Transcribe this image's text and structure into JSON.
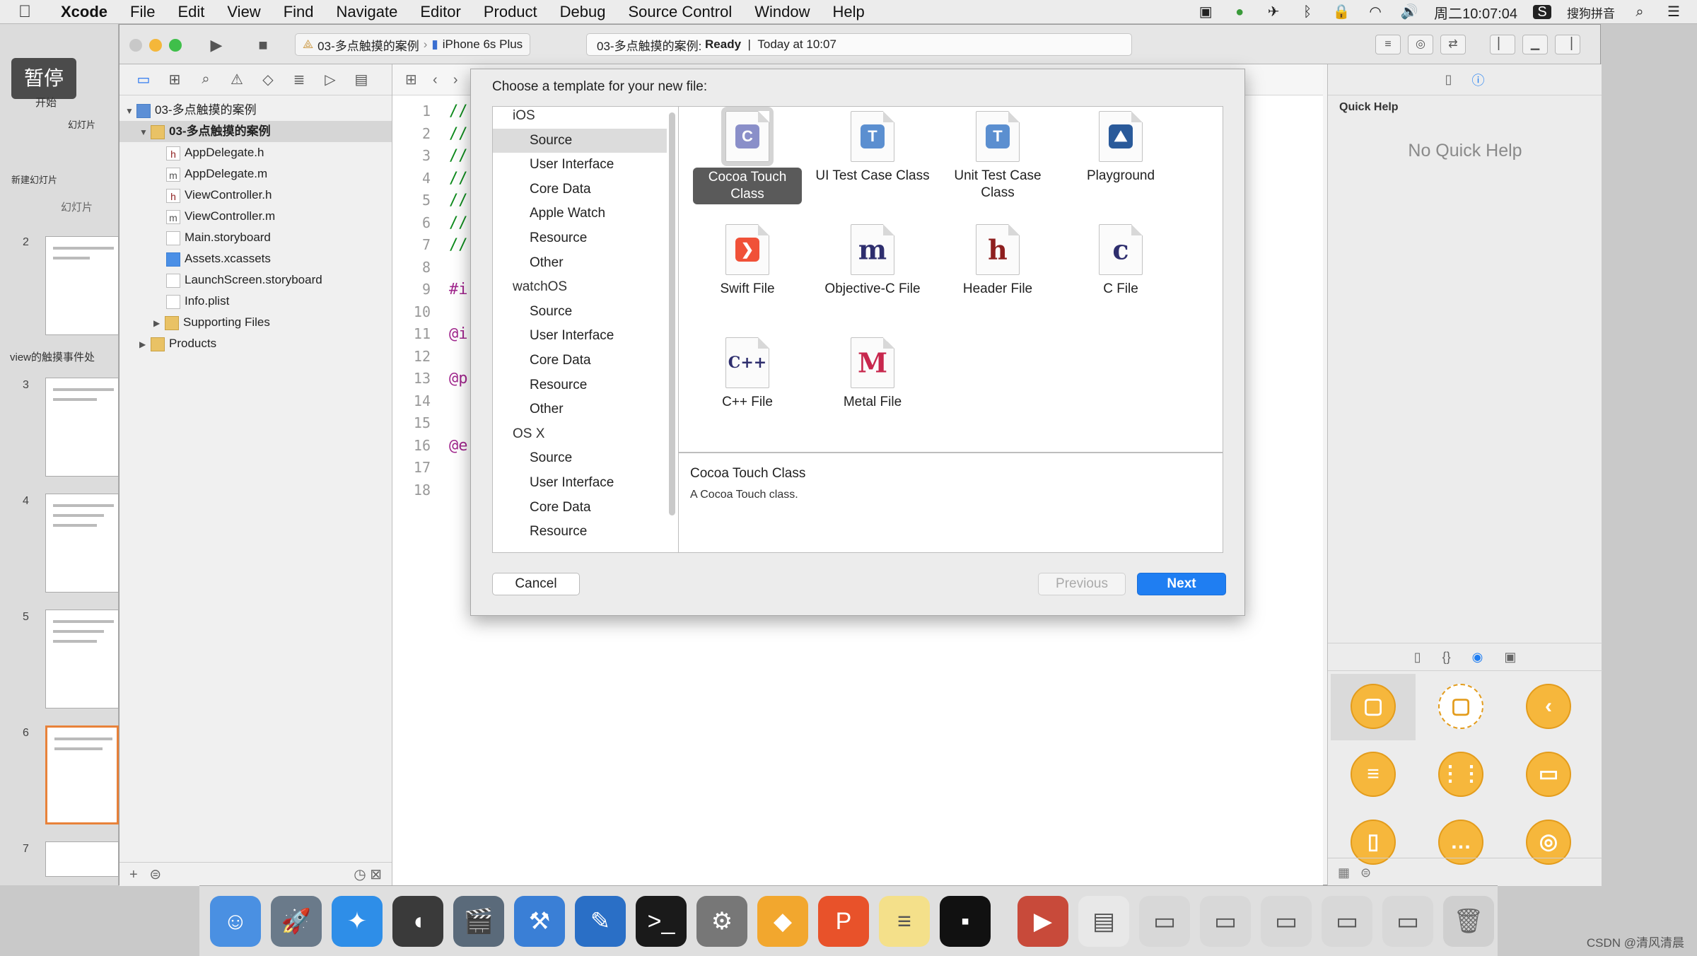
{
  "menubar": {
    "items": [
      "Xcode",
      "File",
      "Edit",
      "View",
      "Find",
      "Navigate",
      "Editor",
      "Product",
      "Debug",
      "Source Control",
      "Window",
      "Help"
    ],
    "clock": "周二10:07:04",
    "input_method": "搜狗拼音"
  },
  "ppt": {
    "pause_label": "暂停",
    "start_label": "开始",
    "slides_tab": "幻灯片",
    "new_slide": "新建幻灯片",
    "section_title": "view的触摸事件处",
    "slide_numbers": [
      "2",
      "3",
      "4",
      "5",
      "6",
      "7"
    ]
  },
  "toolbar": {
    "scheme_project": "03-多点触摸的案例",
    "scheme_device": "iPhone 6s Plus",
    "status_project": "03-多点触摸的案例:",
    "status_state": "Ready",
    "status_time": "Today at 10:07"
  },
  "navigator": {
    "rows": [
      {
        "label": "03-多点触摸的案例",
        "kind": "proj"
      },
      {
        "label": "03-多点触摸的案例",
        "kind": "folder"
      },
      {
        "label": "AppDelegate.h",
        "kind": "h"
      },
      {
        "label": "AppDelegate.m",
        "kind": "m"
      },
      {
        "label": "ViewController.h",
        "kind": "h"
      },
      {
        "label": "ViewController.m",
        "kind": "m"
      },
      {
        "label": "Main.storyboard",
        "kind": "sb"
      },
      {
        "label": "Assets.xcassets",
        "kind": "assets"
      },
      {
        "label": "LaunchScreen.storyboard",
        "kind": "sb"
      },
      {
        "label": "Info.plist",
        "kind": "plist"
      },
      {
        "label": "Supporting Files",
        "kind": "folder"
      },
      {
        "label": "Products",
        "kind": "folder"
      }
    ]
  },
  "editor": {
    "line_numbers": [
      "1",
      "2",
      "3",
      "4",
      "5",
      "6",
      "7",
      "8",
      "9",
      "10",
      "11",
      "12",
      "13",
      "14",
      "15",
      "16",
      "17",
      "18"
    ],
    "lines": [
      "//",
      "//",
      "//",
      "//",
      "//",
      "//",
      "//",
      "",
      "#i",
      "",
      "@i",
      "",
      "@p",
      "",
      "",
      "@e",
      "",
      ""
    ]
  },
  "dialog": {
    "title": "Choose a template for your new file:",
    "categories": [
      {
        "label": "iOS",
        "type": "group"
      },
      {
        "label": "Source",
        "type": "item",
        "selected": true
      },
      {
        "label": "User Interface",
        "type": "item"
      },
      {
        "label": "Core Data",
        "type": "item"
      },
      {
        "label": "Apple Watch",
        "type": "item"
      },
      {
        "label": "Resource",
        "type": "item"
      },
      {
        "label": "Other",
        "type": "item"
      },
      {
        "label": "watchOS",
        "type": "group"
      },
      {
        "label": "Source",
        "type": "item"
      },
      {
        "label": "User Interface",
        "type": "item"
      },
      {
        "label": "Core Data",
        "type": "item"
      },
      {
        "label": "Resource",
        "type": "item"
      },
      {
        "label": "Other",
        "type": "item"
      },
      {
        "label": "OS X",
        "type": "group"
      },
      {
        "label": "Source",
        "type": "item"
      },
      {
        "label": "User Interface",
        "type": "item"
      },
      {
        "label": "Core Data",
        "type": "item"
      },
      {
        "label": "Resource",
        "type": "item"
      }
    ],
    "templates": [
      {
        "label": "Cocoa Touch Class",
        "glyph": "C",
        "icon": "cocoa-touch-class-icon",
        "color": "#8a8fc9",
        "selected": true
      },
      {
        "label": "UI Test Case Class",
        "glyph": "T",
        "icon": "ui-test-case-icon",
        "color": "#5b8fd0"
      },
      {
        "label": "Unit Test Case Class",
        "glyph": "T",
        "icon": "unit-test-case-icon",
        "color": "#5b8fd0"
      },
      {
        "label": "Playground",
        "glyph": "⛰",
        "icon": "playground-icon",
        "color": "#2a5a9a"
      },
      {
        "label": "Swift File",
        "glyph": "❯",
        "icon": "swift-file-icon",
        "color": "#f05138"
      },
      {
        "label": "Objective-C File",
        "glyph": "m",
        "icon": "objective-c-file-icon",
        "color": "#2e2e6e"
      },
      {
        "label": "Header File",
        "glyph": "h",
        "icon": "header-file-icon",
        "color": "#8e1f1f"
      },
      {
        "label": "C File",
        "glyph": "c",
        "icon": "c-file-icon",
        "color": "#2e2e6e"
      },
      {
        "label": "C++ File",
        "glyph": "C++",
        "icon": "cpp-file-icon",
        "color": "#2e2e6e"
      },
      {
        "label": "Metal File",
        "glyph": "M",
        "icon": "metal-file-icon",
        "color": "#c8284e"
      }
    ],
    "description_title": "Cocoa Touch Class",
    "description_text": "A Cocoa Touch class.",
    "cancel_label": "Cancel",
    "previous_label": "Previous",
    "next_label": "Next"
  },
  "utilities": {
    "quick_help_label": "Quick Help",
    "no_quick_help": "No Quick Help"
  },
  "watermark": "CSDN @清风清晨",
  "colors": {
    "accent": "#1f7ef2",
    "object_library": "#f6b73c"
  }
}
